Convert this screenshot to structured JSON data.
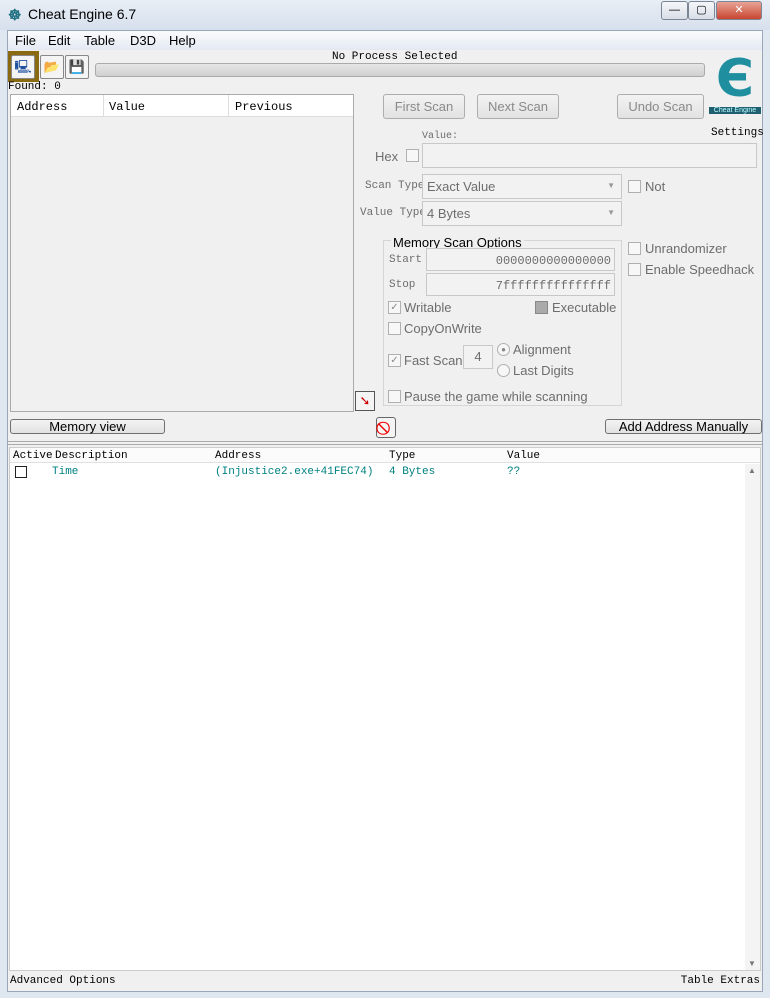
{
  "window": {
    "title": "Cheat Engine 6.7",
    "minimize": "—",
    "maximize": "▢",
    "close": "✕"
  },
  "menu": [
    "File",
    "Edit",
    "Table",
    "D3D",
    "Help"
  ],
  "toolbar": {
    "process_icon": "computer-search-icon",
    "open_icon": "folder-open-icon",
    "save_icon": "floppy-disk-icon"
  },
  "process_label": "No Process Selected",
  "found": "Found: 0",
  "results_columns": [
    "Address",
    "Value",
    "Previous"
  ],
  "scan": {
    "first_scan": "First Scan",
    "next_scan": "Next Scan",
    "undo_scan": "Undo Scan",
    "settings": "Settings",
    "logo_text": "Cheat Engine",
    "value_label": "Value:",
    "hex_label": "Hex",
    "value": "",
    "scan_type_label": "Scan Type",
    "scan_type": "Exact Value",
    "not_label": "Not",
    "value_type_label": "Value Type",
    "value_type": "4 Bytes",
    "memory_options": {
      "title": "Memory Scan Options",
      "start_label": "Start",
      "start": "0000000000000000",
      "stop_label": "Stop",
      "stop": "7fffffffffffffff",
      "writable": "Writable",
      "executable": "Executable",
      "copyonwrite": "CopyOnWrite",
      "fast_scan": "Fast Scan",
      "fast_scan_value": "4",
      "alignment": "Alignment",
      "last_digits": "Last Digits",
      "pause": "Pause the game while scanning"
    },
    "unrandomizer": "Unrandomizer",
    "speedhack": "Enable Speedhack"
  },
  "memory_view": "Memory view",
  "add_address": "Add Address Manually",
  "table": {
    "columns": [
      "Active",
      "Description",
      "Address",
      "Type",
      "Value"
    ],
    "rows": [
      {
        "active": false,
        "description": "Time",
        "address": "(Injustice2.exe+41FEC74)",
        "type": "4 Bytes",
        "value": "??"
      }
    ]
  },
  "footer": {
    "left": "Advanced Options",
    "right": "Table Extras"
  },
  "colors": {
    "entry_text": "#008080",
    "logo": "#1f8fa0"
  }
}
